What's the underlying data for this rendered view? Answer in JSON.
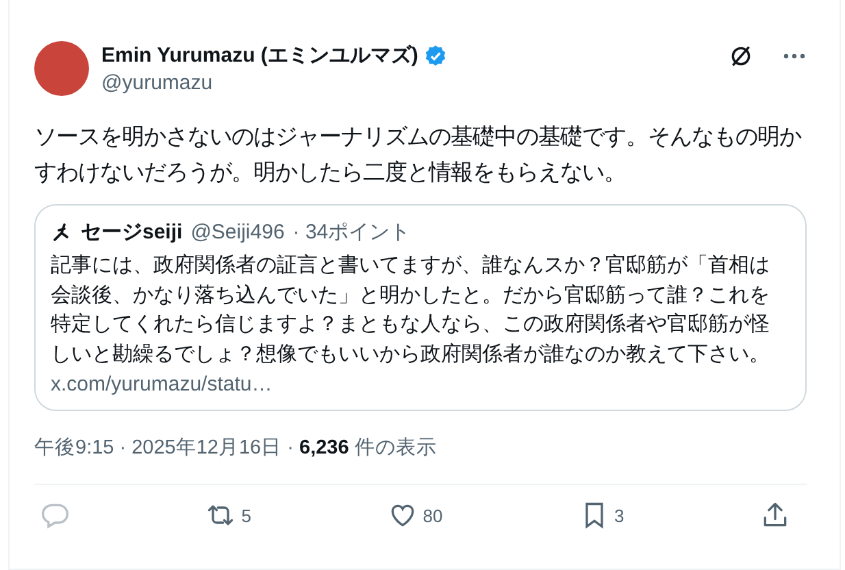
{
  "author": {
    "name": "Emin Yurumazu (エミンユルマズ)",
    "handle": "@yurumazu",
    "verified": true
  },
  "body": "ソースを明かさないのはジャーナリズムの基礎中の基礎です。そんなもの明かすわけないだろうが。明かしたら二度と情報をもらえない。",
  "quote": {
    "name": "セージseiji",
    "handle": "@Seiji496",
    "points": "· 34ポイント",
    "text": "記事には、政府関係者の証言と書いてますが、誰なんスか？官邸筋が「首相は会談後、かなり落ち込んでいた」と明かしたと。だから官邸筋って誰？これを特定してくれたら信じますよ？まともな人なら、この政府関係者や官邸筋が怪しいと勘繰るでしょ？想像でもいいから政府関係者が誰なのか教えて下さい。",
    "link": "x.com/yurumazu/statu…"
  },
  "meta": {
    "time": "午後9:15 · 2025年12月16日 · ",
    "views": "6,236",
    "views_label": " 件の表示"
  },
  "actions": [
    {
      "kind": "reply"
    },
    {
      "kind": "repost",
      "count": "5"
    },
    {
      "kind": "like",
      "count": "80"
    },
    {
      "kind": "bookmark",
      "count": "3"
    },
    {
      "kind": "share"
    }
  ]
}
